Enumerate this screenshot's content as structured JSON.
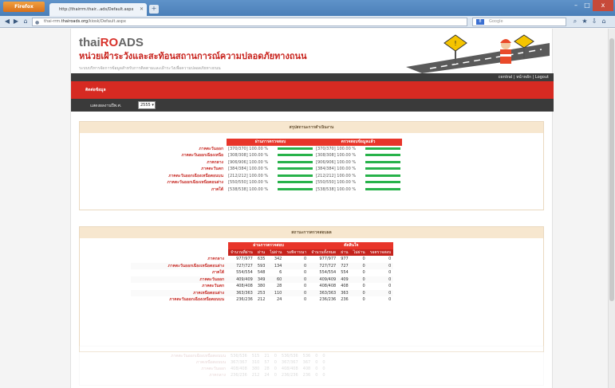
{
  "browser": {
    "menu_label": "Firefox",
    "tab_title": "http://thairrm.thair...ads/Default.aspx",
    "url_prefix": "thai-rrm.",
    "url_host": "thairoads.org",
    "url_path": "/kiosk/Default.aspx",
    "search_placeholder": "Google",
    "new_tab": "+",
    "win_min": "–",
    "win_max": "□",
    "win_close": "x"
  },
  "site": {
    "logo_part1": "thai",
    "logo_part2": "R",
    "logo_part3": "O",
    "logo_part4": "ADS",
    "title": "หน่วยเฝ้าระวังและสะท้อนสถานการณ์ความปลอดภัยทางถนน",
    "subtitle": "ระบบบริหารจัดการข้อมูลสำหรับการติดตามและเฝ้าระวังเพื่อความปลอดภัยทางถนน",
    "top_links": "central | หน้าหลัก | Logout",
    "red_label": "ติดต่อข้อมูล",
    "year_label": "แสดงผลงานปีพ.ศ.",
    "year_value": "2555 ▾"
  },
  "section1": {
    "title": "สรุปสถานะการดำเนินงาน",
    "col1": "ผ่านการตรวจสอบ",
    "col2": "ตรวจสอบข้อมูลแล้ว",
    "rows": [
      {
        "name": "ภาคตะวันออก",
        "v1": "[370/370] 100.00 %",
        "v2": "[370/370] 100.00 %"
      },
      {
        "name": "ภาคตะวันออกเฉียงเหนือ",
        "v1": "[308/308] 100.00 %",
        "v2": "[308/308] 100.00 %"
      },
      {
        "name": "ภาคกลาง",
        "v1": "[906/906] 100.00 %",
        "v2": "[906/906] 100.00 %"
      },
      {
        "name": "ภาคตะวันตก",
        "v1": "[384/384] 100.00 %",
        "v2": "[384/384] 100.00 %"
      },
      {
        "name": "ภาคตะวันออกเฉียงเหนือตอนบน",
        "v1": "[212/212] 100.00 %",
        "v2": "[212/212] 100.00 %"
      },
      {
        "name": "ภาคตะวันออกเฉียงเหนือตอนล่าง",
        "v1": "[550/550] 100.00 %",
        "v2": "[550/550] 100.00 %"
      },
      {
        "name": "ภาคใต้",
        "v1": "[538/538] 100.00 %",
        "v2": "[538/538] 100.00 %"
      }
    ]
  },
  "section2": {
    "title": "สถานะการตรวจสอบผล",
    "group1": "ผ่านการตรวจสอบ",
    "group2": "ตัดสินใจ",
    "headers": [
      "จำนวนที่ผ่าน",
      "ผ่าน",
      "ไม่ผ่าน",
      "รอพิจารณา",
      "จำนวนทั้งหมด",
      "ผ่าน",
      "ไม่ผ่าน",
      "รอตรวจสอบ"
    ],
    "rows": [
      {
        "name": "ภาคกลาง",
        "c": [
          "977/977",
          "635",
          "342",
          "0",
          "977/977",
          "977",
          "0",
          "0"
        ]
      },
      {
        "name": "ภาคตะวันออกเฉียงเหนือตอนล่าง",
        "c": [
          "727/727",
          "593",
          "134",
          "0",
          "727/727",
          "727",
          "0",
          "0"
        ]
      },
      {
        "name": "ภาคใต้",
        "c": [
          "554/554",
          "548",
          "6",
          "0",
          "554/554",
          "554",
          "0",
          "0"
        ]
      },
      {
        "name": "ภาคตะวันออก",
        "c": [
          "409/409",
          "349",
          "60",
          "0",
          "409/409",
          "409",
          "0",
          "0"
        ]
      },
      {
        "name": "ภาคตะวันตก",
        "c": [
          "408/408",
          "380",
          "28",
          "0",
          "408/408",
          "408",
          "0",
          "0"
        ]
      },
      {
        "name": "ภาคเหนือตอนล่าง",
        "c": [
          "363/363",
          "253",
          "110",
          "0",
          "363/363",
          "363",
          "0",
          "0"
        ]
      },
      {
        "name": "ภาคตะวันออกเฉียงเหนือตอนบน",
        "c": [
          "236/236",
          "212",
          "24",
          "0",
          "236/236",
          "236",
          "0",
          "0"
        ]
      }
    ]
  },
  "section3": {
    "rows": [
      {
        "name": "ภาคตะวันออกเฉียงเหนือตอนบน",
        "c": [
          "536/536",
          "515",
          "21",
          "0",
          "536/536",
          "536",
          "0",
          "0"
        ]
      },
      {
        "name": "ภาคเหนือตอนบน",
        "c": [
          "367/367",
          "310",
          "57",
          "0",
          "367/367",
          "367",
          "0",
          "0"
        ]
      },
      {
        "name": "ภาคตะวันออก",
        "c": [
          "408/408",
          "380",
          "28",
          "0",
          "408/408",
          "408",
          "0",
          "0"
        ]
      },
      {
        "name": "ภาคกลาง",
        "c": [
          "236/236",
          "212",
          "24",
          "0",
          "236/236",
          "236",
          "0",
          "0"
        ]
      }
    ]
  },
  "colors": {
    "brand_red": "#d62a22",
    "progress_green": "#27b24a",
    "header_beige": "#f7e7cf"
  }
}
